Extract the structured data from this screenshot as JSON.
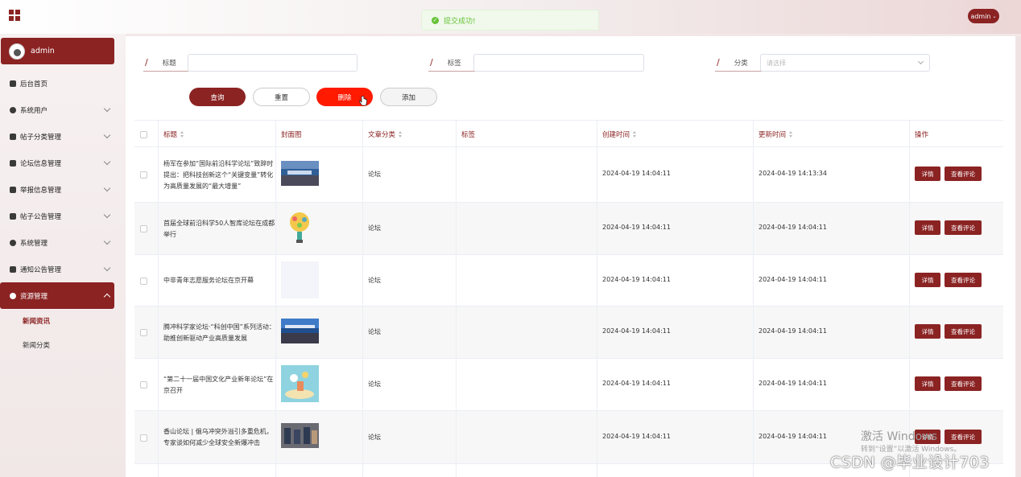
{
  "toast": {
    "text": "提交成功!"
  },
  "user": {
    "name": "admin",
    "menu_label": "admin"
  },
  "sidebar": {
    "user_name": "admin",
    "items": [
      {
        "label": "后台首页"
      },
      {
        "label": "系统用户"
      },
      {
        "label": "帖子分类管理"
      },
      {
        "label": "论坛信息管理"
      },
      {
        "label": "举报信息管理"
      },
      {
        "label": "帖子公告管理"
      },
      {
        "label": "系统管理"
      },
      {
        "label": "通知公告管理"
      },
      {
        "label": "资源管理"
      }
    ],
    "sub_items": [
      {
        "label": "新闻资讯"
      },
      {
        "label": "新闻分类"
      }
    ]
  },
  "filters": {
    "title_label": "标题",
    "tag_label": "标签",
    "category_label": "分类",
    "category_placeholder": "请选择"
  },
  "buttons": {
    "query": "查询",
    "reset": "重置",
    "delete": "删除",
    "add": "添加"
  },
  "table": {
    "headers": {
      "title": "标题",
      "cover": "封面图",
      "category": "文章分类",
      "tags": "标签",
      "created": "创建时间",
      "updated": "更新时间",
      "actions": "操作"
    },
    "rows": [
      {
        "title": "杨军在参加“国际前沿科学论坛”致辞时提出：把科技创新这个“关键变量”转化为高质量发展的“最大增量”",
        "category": "论坛",
        "tags": "",
        "created": "2024-04-19 14:04:11",
        "updated": "2024-04-19 14:13:34"
      },
      {
        "title": "首届全球前沿科学50人智库论坛在成都举行",
        "category": "论坛",
        "tags": "",
        "created": "2024-04-19 14:04:11",
        "updated": "2024-04-19 14:04:11"
      },
      {
        "title": "中非青年志愿服务论坛在京开幕",
        "category": "论坛",
        "tags": "",
        "created": "2024-04-19 14:04:11",
        "updated": "2024-04-19 14:04:11"
      },
      {
        "title": "腾冲科学家论坛·“科创中国”系列活动：助推创新驱动产业高质量发展",
        "category": "论坛",
        "tags": "",
        "created": "2024-04-19 14:04:11",
        "updated": "2024-04-19 14:04:11"
      },
      {
        "title": "“第二十一届中国文化产业新年论坛”在京召开",
        "category": "论坛",
        "tags": "",
        "created": "2024-04-19 14:04:11",
        "updated": "2024-04-19 14:04:11"
      },
      {
        "title": "香山论坛 | 俄乌冲突外溢引多重危机，专家谈如何减少全球安全新爆冲击",
        "category": "论坛",
        "tags": "",
        "created": "2024-04-19 14:04:11",
        "updated": "2024-04-19 14:04:11"
      }
    ],
    "detail_label": "详情",
    "comments_label": "查看评论"
  },
  "watermark": {
    "activate": "激活 Windows",
    "activate_hint": "转到“设置”以激活 Windows。",
    "csdn": "CSDN @毕业设计703"
  },
  "colors": {
    "brand": "#8b2323",
    "danger": "#ff1a00",
    "success": "#67c23a"
  }
}
